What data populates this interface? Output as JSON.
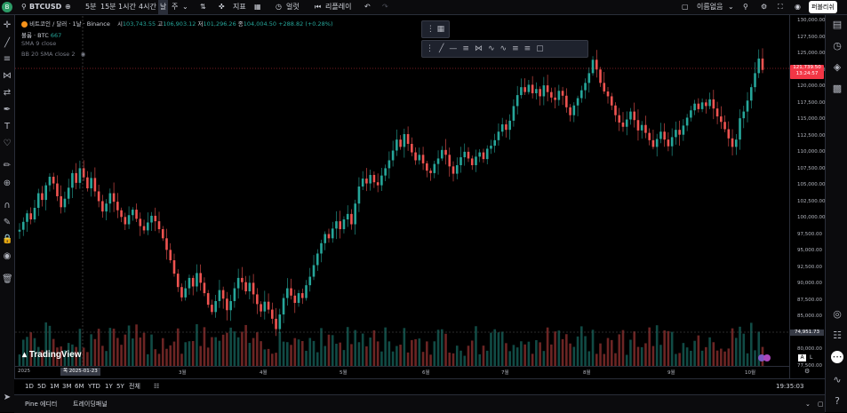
{
  "header": {
    "symbol": "BTCUSD",
    "intervals": [
      "5분",
      "15분",
      "1시간",
      "4시간",
      "날",
      "주"
    ],
    "active_interval": "날",
    "indicators_label": "지표",
    "alert_label": "얼럿",
    "replay_label": "리플레이",
    "layout_name": "이름없음",
    "publish_label": "퍼블리쉬"
  },
  "legend": {
    "title": "비트코인 / 달러 · 1날 · Binance",
    "ohlc": {
      "o_label": "시",
      "o": "103,743.55",
      "h_label": "고",
      "h": "106,903.12",
      "l_label": "저",
      "l": "101,296.26",
      "c_label": "종",
      "c": "104,004.50",
      "change": "+288.82 (+0.28%)"
    },
    "volume": {
      "label": "볼륨 · BTC",
      "value": "667"
    },
    "sma": "SMA 9 close",
    "bb": "BB 20 SMA close 2"
  },
  "price_axis": {
    "ticks": [
      "130,000.00",
      "127,500.00",
      "125,000.00",
      "122,500.00",
      "120,000.00",
      "117,500.00",
      "115,000.00",
      "112,500.00",
      "110,000.00",
      "107,500.00",
      "105,000.00",
      "102,500.00",
      "100,000.00",
      "97,500.00",
      "95,000.00",
      "92,500.00",
      "90,000.00",
      "87,500.00",
      "85,000.00",
      "82,500.00",
      "80,000.00",
      "77,500.00"
    ],
    "last_price": "121,739.50",
    "countdown": "13:24:57",
    "crosshair_price": "74,951.73"
  },
  "time_axis": {
    "labels": [
      {
        "text": "2025"
      },
      {
        "text": "3월"
      },
      {
        "text": "4월"
      },
      {
        "text": "5월"
      },
      {
        "text": "6월"
      },
      {
        "text": "7월"
      },
      {
        "text": "8월"
      },
      {
        "text": "9월"
      },
      {
        "text": "10월"
      }
    ],
    "crosshair_date": "목 2025-01-23"
  },
  "watermark": "TradingView",
  "bottom": {
    "ranges": [
      "1D",
      "5D",
      "1M",
      "3M",
      "6M",
      "YTD",
      "1Y",
      "5Y",
      "전체"
    ],
    "clock": "19:35:03 UTC+9"
  },
  "footer": {
    "tabs": [
      "Pine 에디터",
      "트레이딩패널"
    ]
  },
  "colors": {
    "up": "#26a69a",
    "down": "#ef5350",
    "last_price": "#f23645"
  },
  "chart_data": {
    "type": "candlestick",
    "series": [
      {
        "name": "BTCUSD",
        "note": "approximate daily closes, Jan–Oct 2025"
      }
    ],
    "ylim": [
      76000,
      130000
    ],
    "closes": [
      95500,
      96800,
      98200,
      97200,
      99100,
      101500,
      100400,
      102800,
      104200,
      103100,
      101000,
      99200,
      100600,
      102400,
      104800,
      103200,
      105600,
      104100,
      102300,
      104000,
      101800,
      100200,
      98500,
      99800,
      101500,
      100100,
      98700,
      97600,
      96400,
      97900,
      98800,
      97300,
      96100,
      95400,
      96700,
      97800,
      96900,
      95600,
      94100,
      92200,
      90500,
      88300,
      86100,
      84400,
      85900,
      87600,
      86200,
      88400,
      86800,
      85100,
      83200,
      82000,
      83800,
      85600,
      84200,
      82300,
      83800,
      85900,
      87600,
      86900,
      85400,
      86800,
      84900,
      83300,
      82100,
      83700,
      82400,
      80900,
      79200,
      81600,
      84300,
      85900,
      84700,
      83500,
      85100,
      84300,
      86400,
      87800,
      89700,
      91600,
      93300,
      94800,
      94100,
      95700,
      96900,
      95600,
      97200,
      98100,
      96400,
      99800,
      102600,
      103900,
      103100,
      104500,
      103300,
      102800,
      104400,
      105600,
      106900,
      108500,
      110300,
      109100,
      111200,
      109600,
      108200,
      106900,
      107800,
      106400,
      105200,
      104800,
      106300,
      107200,
      108600,
      107800,
      105900,
      104700,
      106100,
      107400,
      108300,
      107200,
      106100,
      107500,
      108200,
      107100,
      108800,
      109300,
      110200,
      111600,
      112800,
      111900,
      113400,
      115800,
      117600,
      118900,
      118100,
      119300,
      117900,
      118600,
      117400,
      119200,
      118100,
      117200,
      116800,
      118300,
      117500,
      115600,
      114300,
      115900,
      117100,
      118400,
      119600,
      121200,
      123400,
      121800,
      119600,
      118200,
      117400,
      115900,
      114300,
      113100,
      112400,
      113600,
      114900,
      113500,
      111800,
      112700,
      111400,
      110200,
      109100,
      110400,
      111600,
      110300,
      109200,
      110700,
      111900,
      111100,
      112600,
      113900,
      115100,
      116200,
      115300,
      116400,
      115800,
      116900,
      115400,
      114100,
      113200,
      112000,
      110500,
      109100,
      110300,
      113800,
      114900,
      116700,
      118900,
      121200,
      123600,
      121739
    ]
  }
}
